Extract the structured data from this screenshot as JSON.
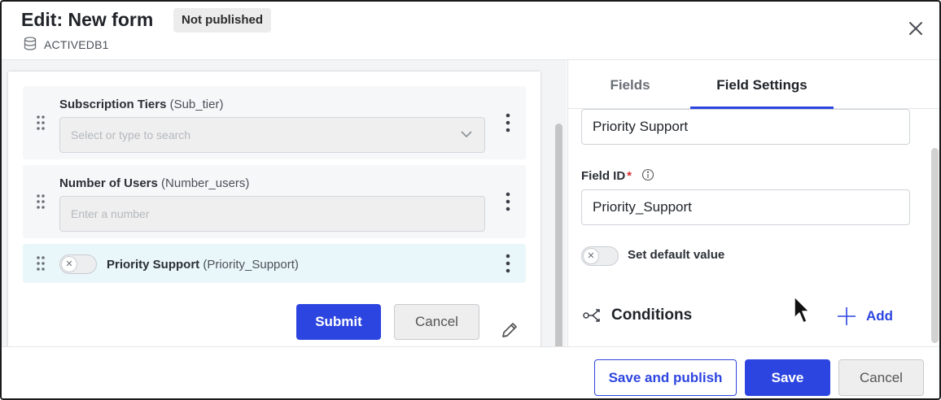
{
  "header": {
    "title": "Edit: New form",
    "status_badge": "Not published",
    "database": "ACTIVEDB1"
  },
  "form": {
    "fields": [
      {
        "label": "Subscription Tiers",
        "id": "(Sub_tier)",
        "type": "select",
        "placeholder": "Select or type to search"
      },
      {
        "label": "Number of Users",
        "id": "(Number_users)",
        "type": "number",
        "placeholder": "Enter a number"
      },
      {
        "label": "Priority Support",
        "id": "(Priority_Support)",
        "type": "toggle",
        "value": "off"
      }
    ],
    "submit_label": "Submit",
    "cancel_label": "Cancel"
  },
  "settings": {
    "tabs": [
      {
        "label": "Fields",
        "selected": false
      },
      {
        "label": "Field Settings",
        "selected": true
      }
    ],
    "label_value": "Priority Support",
    "field_id_label": "Field ID",
    "field_id_required": "*",
    "field_id_value": "Priority_Support",
    "default_toggle_label": "Set default value",
    "conditions_title": "Conditions",
    "add_label": "Add"
  },
  "footer": {
    "save_publish_label": "Save and publish",
    "save_label": "Save",
    "cancel_label": "Cancel"
  },
  "colors": {
    "accent": "#2d45e0",
    "active_row": "#eaf7fa",
    "required": "#d93030"
  },
  "icons": [
    "database-icon",
    "close-icon",
    "drag-handle-icon",
    "more-vertical-icon",
    "chevron-down-icon",
    "pencil-icon",
    "info-icon",
    "conditions-icon",
    "plus-icon",
    "mouse-cursor-icon"
  ]
}
